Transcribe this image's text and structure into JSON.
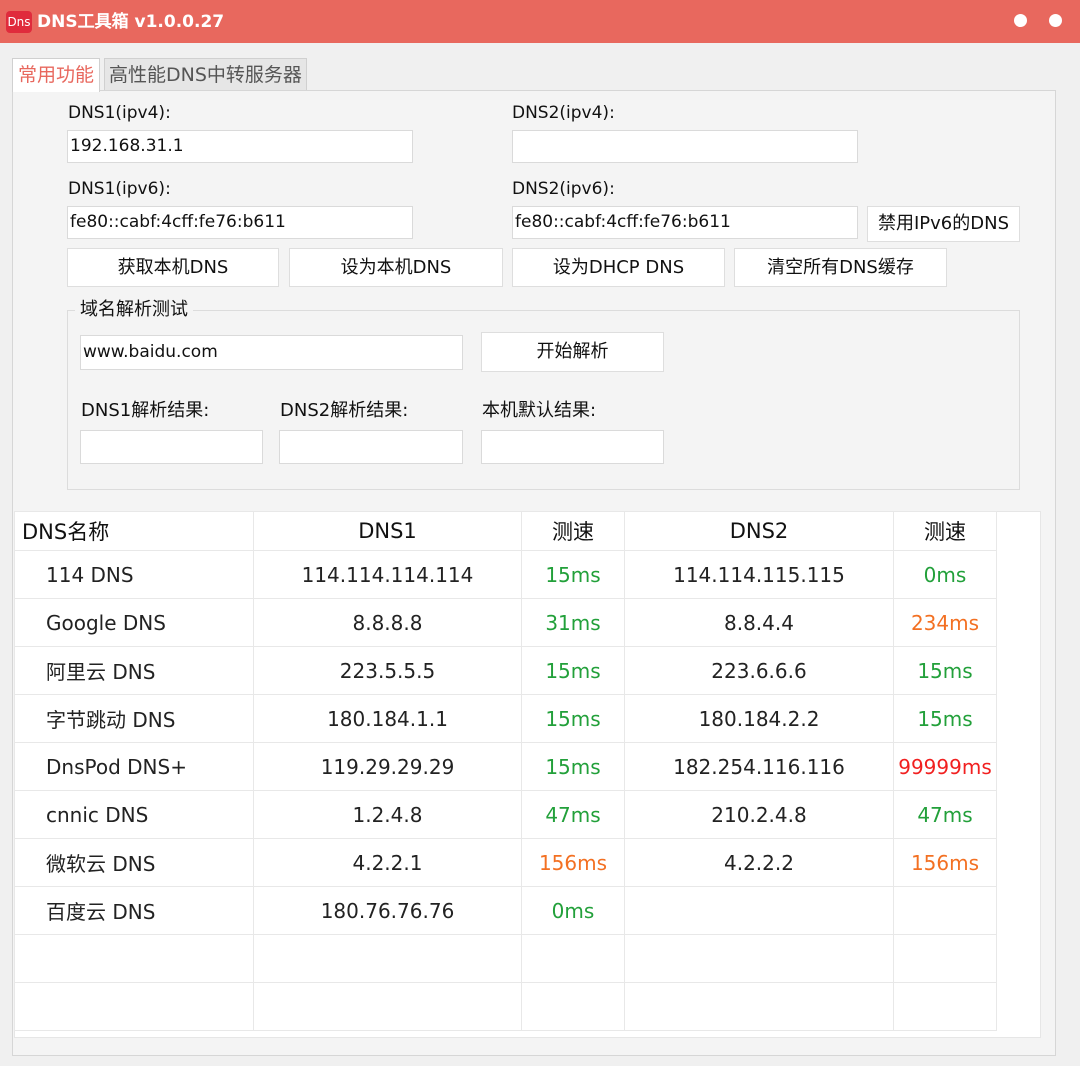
{
  "window": {
    "logo_text": "Dns",
    "title": "DNS工具箱 v1.0.0.27",
    "title_bar_color": "#e8685e"
  },
  "tabs": [
    {
      "label": "常用功能",
      "active": true
    },
    {
      "label": "高性能DNS中转服务器",
      "active": false
    }
  ],
  "form": {
    "dns1_ipv4_label": "DNS1(ipv4):",
    "dns1_ipv4_value": "192.168.31.1",
    "dns2_ipv4_label": "DNS2(ipv4):",
    "dns2_ipv4_value": "",
    "dns1_ipv6_label": "DNS1(ipv6):",
    "dns1_ipv6_value": "fe80::cabf:4cff:fe76:b611",
    "dns2_ipv6_label": "DNS2(ipv6):",
    "dns2_ipv6_value": "fe80::cabf:4cff:fe76:b611",
    "disable_ipv6_button": "禁用IPv6的DNS"
  },
  "actions": {
    "get_local_dns": "获取本机DNS",
    "set_local_dns": "设为本机DNS",
    "set_dhcp_dns": "设为DHCP DNS",
    "flush_dns_cache": "清空所有DNS缓存"
  },
  "resolve_test": {
    "group_title": "域名解析测试",
    "domain_value": "www.baidu.com",
    "start_button": "开始解析",
    "dns1_result_label": "DNS1解析结果:",
    "dns1_result_value": "",
    "dns2_result_label": "DNS2解析结果:",
    "dns2_result_value": "",
    "local_result_label": "本机默认结果:",
    "local_result_value": ""
  },
  "table": {
    "headers": {
      "name": "DNS名称",
      "dns1": "DNS1",
      "speed1": "测速",
      "dns2": "DNS2",
      "speed2": "测速"
    },
    "speed_colors": {
      "green": "#22a03a",
      "orange": "#f37022",
      "red": "#f12020"
    },
    "rows": [
      {
        "name": "114 DNS",
        "dns1": "114.114.114.114",
        "speed1": "15ms",
        "speed1_color": "green",
        "dns2": "114.114.115.115",
        "speed2": "0ms",
        "speed2_color": "green"
      },
      {
        "name": "Google DNS",
        "dns1": "8.8.8.8",
        "speed1": "31ms",
        "speed1_color": "green",
        "dns2": "8.8.4.4",
        "speed2": "234ms",
        "speed2_color": "orange"
      },
      {
        "name": "阿里云 DNS",
        "dns1": "223.5.5.5",
        "speed1": "15ms",
        "speed1_color": "green",
        "dns2": "223.6.6.6",
        "speed2": "15ms",
        "speed2_color": "green"
      },
      {
        "name": "字节跳动 DNS",
        "dns1": "180.184.1.1",
        "speed1": "15ms",
        "speed1_color": "green",
        "dns2": "180.184.2.2",
        "speed2": "15ms",
        "speed2_color": "green"
      },
      {
        "name": "DnsPod DNS+",
        "dns1": "119.29.29.29",
        "speed1": "15ms",
        "speed1_color": "green",
        "dns2": "182.254.116.116",
        "speed2": "99999ms",
        "speed2_color": "red"
      },
      {
        "name": "cnnic DNS",
        "dns1": "1.2.4.8",
        "speed1": "47ms",
        "speed1_color": "green",
        "dns2": "210.2.4.8",
        "speed2": "47ms",
        "speed2_color": "green"
      },
      {
        "name": "微软云 DNS",
        "dns1": "4.2.2.1",
        "speed1": "156ms",
        "speed1_color": "orange",
        "dns2": "4.2.2.2",
        "speed2": "156ms",
        "speed2_color": "orange"
      },
      {
        "name": "百度云 DNS",
        "dns1": "180.76.76.76",
        "speed1": "0ms",
        "speed1_color": "green",
        "dns2": "",
        "speed2": "",
        "speed2_color": "green"
      },
      {
        "name": "",
        "dns1": "",
        "speed1": "",
        "speed1_color": "green",
        "dns2": "",
        "speed2": "",
        "speed2_color": "green"
      },
      {
        "name": "",
        "dns1": "",
        "speed1": "",
        "speed1_color": "green",
        "dns2": "",
        "speed2": "",
        "speed2_color": "green"
      }
    ]
  }
}
